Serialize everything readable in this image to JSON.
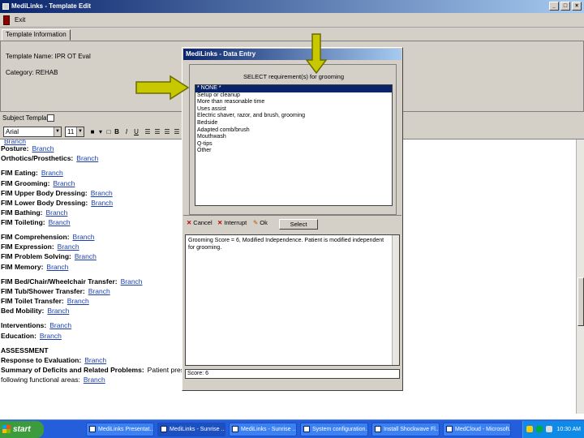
{
  "app": {
    "title": "MediLinks - Template Edit",
    "window_buttons": [
      "_",
      "□",
      "×"
    ]
  },
  "menubar": {
    "exit_label": "Exit"
  },
  "tab": {
    "label": "Template Information"
  },
  "info": {
    "template_name_label": "Template Name: IPR OT Eval",
    "category_label": "Category: REHAB"
  },
  "checkbox_label": "Subject Template",
  "toolbar": {
    "font": "Arial",
    "size": "11",
    "bold": "B",
    "italic": "I",
    "underline": "U"
  },
  "editor_lines": [
    {
      "label": "Posture:",
      "link": "Branch"
    },
    {
      "label": "Orthotics/Prosthetics:",
      "link": "Branch"
    },
    {
      "label": "",
      "link": ""
    },
    {
      "label": "FIM Eating:",
      "link": "Branch"
    },
    {
      "label": "FIM Grooming:",
      "link": "Branch"
    },
    {
      "label": "FIM Upper Body Dressing:",
      "link": "Branch"
    },
    {
      "label": "FIM Lower Body Dressing:",
      "link": "Branch"
    },
    {
      "label": "FIM Bathing:",
      "link": "Branch"
    },
    {
      "label": "FIM Toileting:",
      "link": "Branch"
    },
    {
      "label": "",
      "link": ""
    },
    {
      "label": "FIM Comprehension:",
      "link": "Branch"
    },
    {
      "label": "FIM Expression:",
      "link": "Branch"
    },
    {
      "label": "FIM Problem Solving:",
      "link": "Branch"
    },
    {
      "label": "FIM Memory:",
      "link": "Branch"
    },
    {
      "label": "",
      "link": ""
    },
    {
      "label": "FIM Bed/Chair/Wheelchair Transfer:",
      "link": "Branch"
    },
    {
      "label": "FIM Tub/Shower Transfer:",
      "link": "Branch"
    },
    {
      "label": "FIM Toilet Transfer:",
      "link": "Branch"
    },
    {
      "label": "Bed Mobility:",
      "link": "Branch"
    },
    {
      "label": "",
      "link": ""
    },
    {
      "label": "Interventions:",
      "link": "Branch"
    },
    {
      "label": "Education:",
      "link": "Branch"
    },
    {
      "label": "",
      "link": ""
    },
    {
      "label": "ASSESSMENT",
      "link": ""
    },
    {
      "label": "Response to Evaluation:",
      "link": "Branch"
    },
    {
      "label": "Summary of Deficits and Related Problems:",
      "link": "",
      "tail": "Patient presents with deficits in the"
    },
    {
      "label": "",
      "link": "Branch",
      "tail_prefix": "following functional areas:"
    }
  ],
  "dialog": {
    "title": "MediLinks - Data Entry",
    "prompt": "SELECT requirement(s) for grooming",
    "options": [
      "* NONE *",
      "Setup or cleanup",
      "More than reasonable time",
      "Uses assist",
      "Electric shaver, razor, and brush, grooming",
      "Bedside",
      "Adapted comb/brush",
      "Mouthwash",
      "Q-tips",
      "Other"
    ],
    "select_button": "Select",
    "cancel": "Cancel",
    "interrupt": "Interrupt",
    "ok": "Ok",
    "narrative": "Grooming Score = 6, Modified Independence. Patient is modified independent for grooming.",
    "score": "Score: 6"
  },
  "taskbar": {
    "start": "start",
    "tasks": [
      "MediLinks Presentat...",
      "MediLinks - Sunrise ...",
      "MediLinks - Sunrise ...",
      "System configuration...",
      "Install Shockwave Fl...",
      "MedCloud - Microsoft..."
    ],
    "clock": "10:30 AM"
  },
  "colors": {
    "title_blue": "#0a246a",
    "link_blue": "#1a3fb0",
    "arrow_fill": "#c8c800",
    "arrow_stroke": "#6b6b00",
    "taskbar_blue": "#245edb"
  }
}
